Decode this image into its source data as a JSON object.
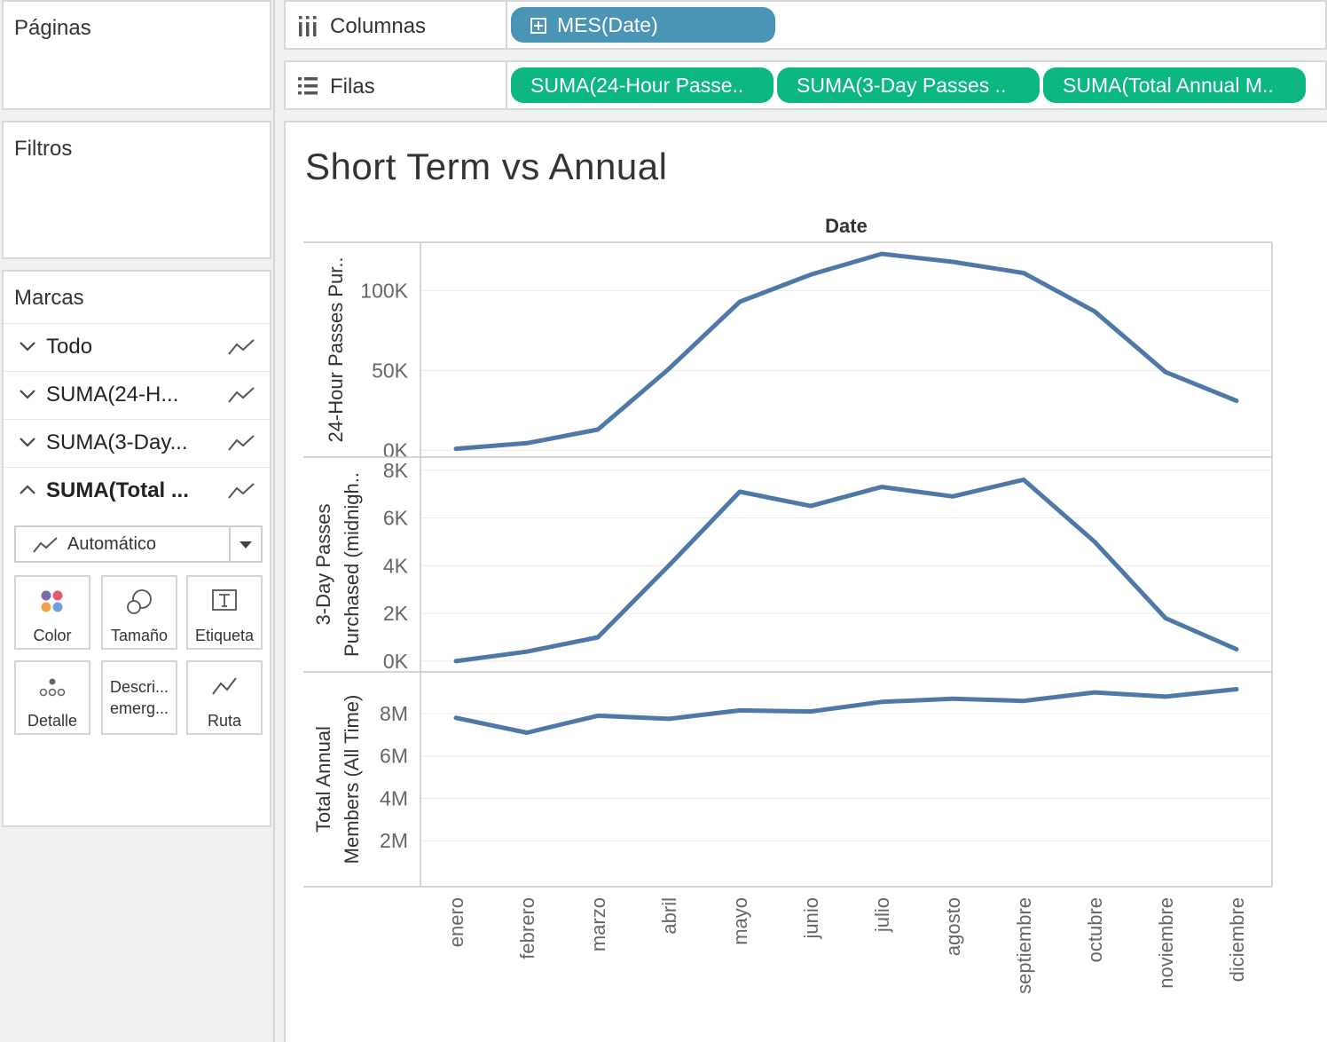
{
  "sidebar": {
    "pages_title": "Páginas",
    "filters_title": "Filtros",
    "marks_title": "Marcas",
    "marks_items": [
      {
        "label": "Todo",
        "expanded": false
      },
      {
        "label": "SUMA(24-H...",
        "expanded": false
      },
      {
        "label": "SUMA(3-Day...",
        "expanded": false
      },
      {
        "label": "SUMA(Total ...",
        "expanded": true
      }
    ],
    "mark_type": "Automático",
    "mark_buttons": {
      "color": "Color",
      "size": "Tamaño",
      "label": "Etiqueta",
      "detail": "Detalle",
      "tooltip_line1": "Descri...",
      "tooltip_line2": "emerg...",
      "path": "Ruta"
    }
  },
  "shelves": {
    "columns_label": "Columnas",
    "rows_label": "Filas",
    "columns_pills": [
      "MES(Date)"
    ],
    "rows_pills": [
      "SUMA(24-Hour Passe..",
      "SUMA(3-Day Passes ..",
      "SUMA(Total Annual M.."
    ]
  },
  "view": {
    "title": "Short Term vs Annual"
  },
  "colors": {
    "line": "#4e79a7",
    "columns_pill": "#4a94b6",
    "rows_pill": "#0db784"
  },
  "chart_data": {
    "type": "line",
    "title": "Short Term vs Annual",
    "xlabel": "Date",
    "categories": [
      "enero",
      "febrero",
      "marzo",
      "abril",
      "mayo",
      "junio",
      "julio",
      "agosto",
      "septiembre",
      "octubre",
      "noviembre",
      "diciembre"
    ],
    "panels": [
      {
        "ylabel": "24-Hour Passes Pur..",
        "yticks": [
          "0K",
          "50K",
          "100K"
        ],
        "tick_values": [
          0,
          50000,
          100000
        ],
        "ylim": [
          -2000,
          128000
        ],
        "values": [
          1000,
          4500,
          13000,
          51000,
          93000,
          110000,
          123000,
          118000,
          111000,
          87000,
          49000,
          31000
        ]
      },
      {
        "ylabel": [
          "3-Day Passes",
          "Purchased (midnigh.."
        ],
        "yticks": [
          "0K",
          "2K",
          "4K",
          "6K",
          "8K"
        ],
        "tick_values": [
          0,
          2000,
          4000,
          6000,
          8000
        ],
        "ylim": [
          -300,
          8400
        ],
        "values": [
          0,
          400,
          1000,
          4000,
          7100,
          6500,
          7300,
          6900,
          7600,
          5000,
          1800,
          500
        ]
      },
      {
        "ylabel": [
          "Total Annual",
          "Members (All Time)"
        ],
        "yticks": [
          "2M",
          "4M",
          "6M",
          "8M"
        ],
        "tick_values": [
          2000000,
          4000000,
          6000000,
          8000000
        ],
        "ylim": [
          0,
          9800000
        ],
        "values": [
          7800000,
          7100000,
          7900000,
          7750000,
          8150000,
          8100000,
          8550000,
          8700000,
          8600000,
          9000000,
          8800000,
          9150000
        ]
      }
    ]
  }
}
